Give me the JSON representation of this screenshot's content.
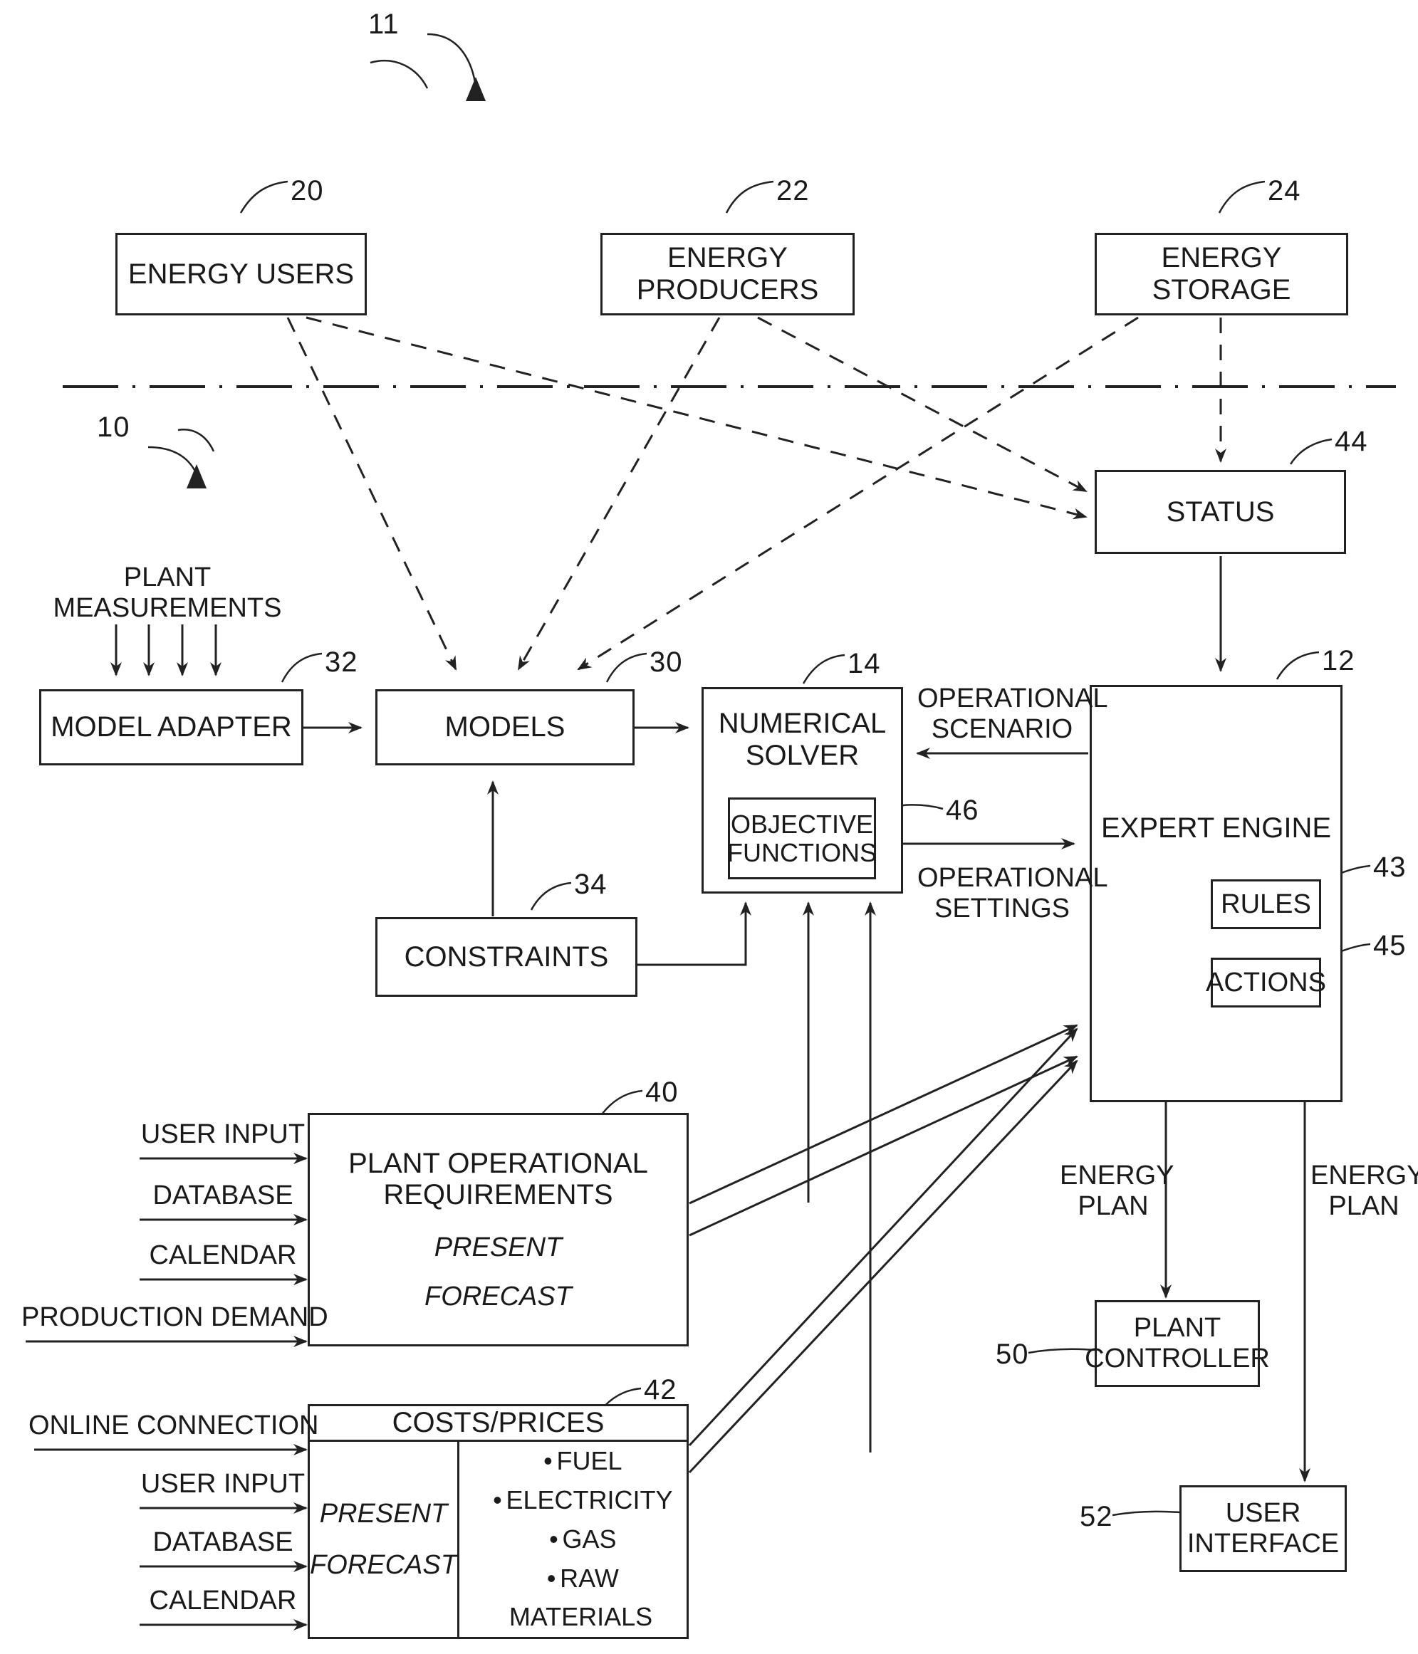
{
  "figure": {
    "ref_system": "11",
    "ref_subsystem": "10"
  },
  "top_blocks": [
    {
      "label": "ENERGY USERS",
      "ref": "20"
    },
    {
      "label": "ENERGY PRODUCERS",
      "ref": "22"
    },
    {
      "label": "ENERGY STORAGE",
      "ref": "24"
    }
  ],
  "status_block": {
    "label": "STATUS",
    "ref": "44"
  },
  "plant_measurements_label": "PLANT\nMEASUREMENTS",
  "model_adapter": {
    "label": "MODEL ADAPTER",
    "ref": "32"
  },
  "models": {
    "label": "MODELS",
    "ref": "30"
  },
  "constraints": {
    "label": "CONSTRAINTS",
    "ref": "34"
  },
  "numerical_solver": {
    "label": "NUMERICAL\nSOLVER",
    "ref": "14",
    "inner": {
      "label": "OBJECTIVE\nFUNCTIONS",
      "ref": "46"
    }
  },
  "expert_engine": {
    "label": "EXPERT ENGINE",
    "ref": "12",
    "rules": {
      "label": "RULES",
      "ref": "43"
    },
    "actions": {
      "label": "ACTIONS",
      "ref": "45"
    }
  },
  "flow_labels": {
    "operational_scenario": "OPERATIONAL\nSCENARIO",
    "operational_settings": "OPERATIONAL\nSETTINGS",
    "energy_plan_left": "ENERGY\nPLAN",
    "energy_plan_right": "ENERGY\nPLAN"
  },
  "plant_operational_requirements": {
    "ref": "40",
    "title": "PLANT OPERATIONAL\nREQUIREMENTS",
    "present": "PRESENT",
    "forecast": "FORECAST",
    "inputs": [
      "USER INPUT",
      "DATABASE",
      "CALENDAR",
      "PRODUCTION DEMAND"
    ]
  },
  "costs_prices": {
    "ref": "42",
    "title": "COSTS/PRICES",
    "present": "PRESENT",
    "forecast": "FORECAST",
    "items": [
      "FUEL",
      "ELECTRICITY",
      "GAS",
      "RAW MATERIALS"
    ],
    "inputs": [
      "ONLINE CONNECTION",
      "USER INPUT",
      "DATABASE",
      "CALENDAR"
    ]
  },
  "plant_controller": {
    "label": "PLANT\nCONTROLLER",
    "ref": "50"
  },
  "user_interface": {
    "label": "USER\nINTERFACE",
    "ref": "52"
  }
}
